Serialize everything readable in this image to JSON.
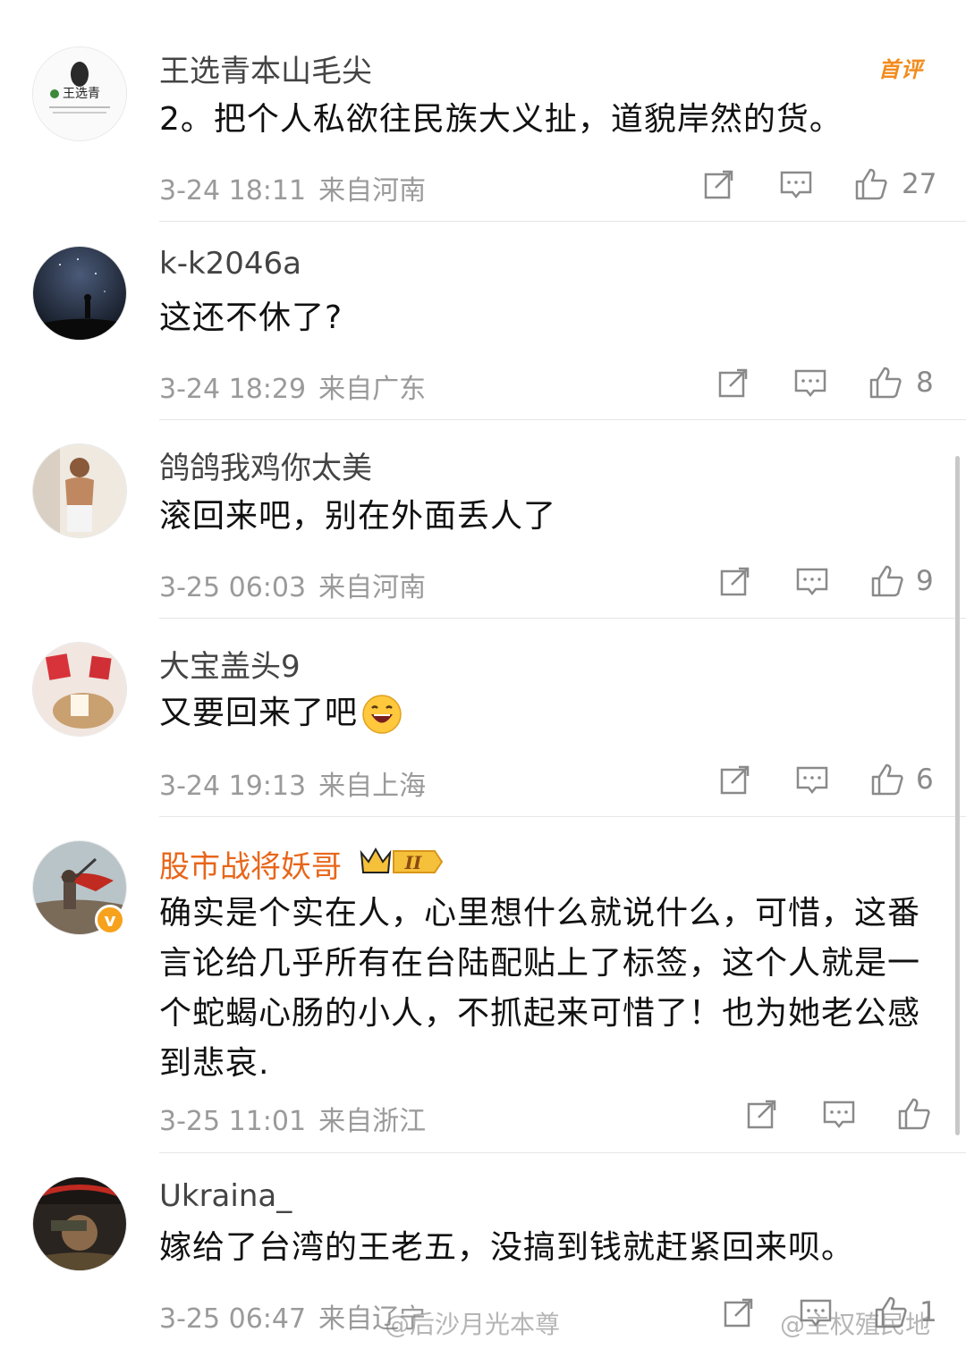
{
  "first_badge": "首评",
  "comments": [
    {
      "username": "王选青本山毛尖",
      "text": "2。把个人私欲往民族大义扯，道貌岸然的货。",
      "time": "3-24 18:11",
      "location": "来自河南",
      "likes": "27"
    },
    {
      "username": "k-k2046a",
      "text": "这还不休了?",
      "time": "3-24 18:29",
      "location": "来自广东",
      "likes": "8"
    },
    {
      "username": "鸽鸽我鸡你太美",
      "text": "滚回来吧，别在外面丢人了",
      "time": "3-25 06:03",
      "location": "来自河南",
      "likes": "9"
    },
    {
      "username": "大宝盖头9",
      "text": "又要回来了吧",
      "time": "3-24 19:13",
      "location": "来自上海",
      "likes": "6"
    },
    {
      "username": "股市战将妖哥",
      "text": "确实是个实在人，心里想什么就说什么，可惜，这番言论给几乎所有在台陆配贴上了标签，这个人就是一个蛇蝎心肠的小人，不抓起来可惜了！也为她老公感到悲哀.",
      "time": "3-25 11:01",
      "location": "来自浙江",
      "likes": ""
    },
    {
      "username": "Ukraina_",
      "text": "嫁给了台湾的王老五，没搞到钱就赶紧回来呗。",
      "time": "3-25 06:47",
      "location": "来自辽宁",
      "likes": "1"
    }
  ],
  "avatar1_brand": "王选青",
  "vip_level": "II",
  "verified_mark": "v",
  "watermarks": [
    "@后沙月光本尊",
    "@主权殖民地"
  ],
  "colors": {
    "vip_name": "#e8661a",
    "badge": "#f28c1e",
    "meta": "#9a9a9a"
  }
}
